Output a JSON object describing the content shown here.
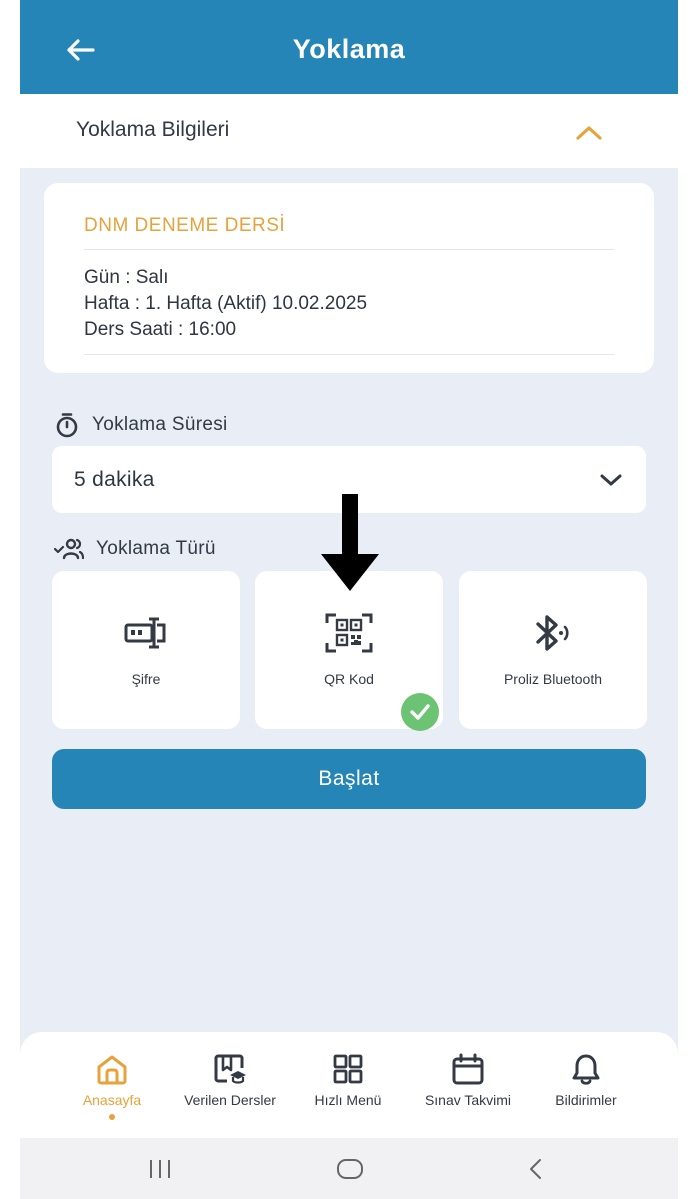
{
  "appbar": {
    "title": "Yoklama"
  },
  "section": {
    "title": "Yoklama Bilgileri"
  },
  "course": {
    "name": "DNM DENEME DERSİ",
    "day": "Gün :  Salı",
    "week": "Hafta :  1. Hafta (Aktif) 10.02.2025",
    "time": "Ders Saati :  16:00"
  },
  "duration": {
    "label": "Yoklama Süresi",
    "value": "5 dakika"
  },
  "type": {
    "label": "Yoklama Türü",
    "options": [
      {
        "label": "Şifre",
        "icon": "password-icon",
        "selected": false
      },
      {
        "label": "QR Kod",
        "icon": "qr-code-icon",
        "selected": true
      },
      {
        "label": "Proliz Bluetooth",
        "icon": "bluetooth-icon",
        "selected": false
      }
    ]
  },
  "start_button": {
    "label": "Başlat"
  },
  "nav": {
    "items": [
      {
        "label": "Anasayfa",
        "icon": "home-icon",
        "active": true
      },
      {
        "label": "Verilen Dersler",
        "icon": "courses-icon",
        "active": false
      },
      {
        "label": "Hızlı Menü",
        "icon": "grid-icon",
        "active": false
      },
      {
        "label": "Sınav Takvimi",
        "icon": "calendar-icon",
        "active": false
      },
      {
        "label": "Bildirimler",
        "icon": "bell-icon",
        "active": false
      }
    ]
  },
  "colors": {
    "primary": "#2585b6",
    "accent": "#e8a23b",
    "background": "#e8edf6",
    "success": "#6cc374"
  }
}
